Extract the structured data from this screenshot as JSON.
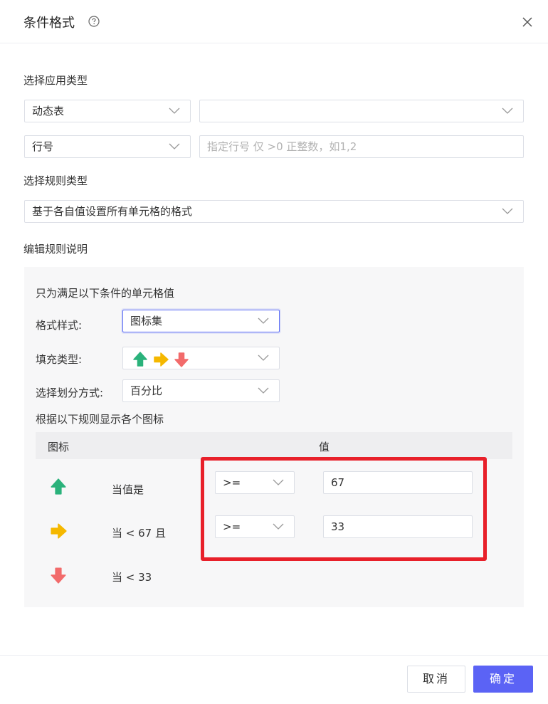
{
  "dialog": {
    "title": "条件格式"
  },
  "sections": {
    "apply_type": "选择应用类型",
    "rule_type": "选择规则类型",
    "edit_rule": "编辑规则说明"
  },
  "apply": {
    "type_select": "动态表",
    "second_select": "",
    "row_select": "行号",
    "row_input_placeholder": "指定行号 仅 >0 正整数，如1,2"
  },
  "rule": {
    "type_select": "基于各自值设置所有单元格的格式"
  },
  "panel": {
    "heading": "只为满足以下条件的单元格值",
    "format_style_label": "格式样式:",
    "format_style_value": "图标集",
    "fill_type_label": "填充类型:",
    "division_label": "选择划分方式:",
    "division_value": "百分比",
    "rules_heading": "根据以下规则显示各个图标",
    "table": {
      "col_icon": "图标",
      "col_value": "值"
    },
    "rows": [
      {
        "icon": "arrow-up-icon",
        "text": "当值是",
        "operator": ">=",
        "value": "67"
      },
      {
        "icon": "arrow-right-icon",
        "text": "当 < 67 且",
        "operator": ">=",
        "value": "33"
      },
      {
        "icon": "arrow-down-icon",
        "text": "当 < 33"
      }
    ]
  },
  "colors": {
    "green": "#2ab27b",
    "yellow": "#f5b800",
    "red": "#f26b6b",
    "primary": "#5b63f5",
    "highlight": "#e8202a"
  },
  "footer": {
    "cancel": "取消",
    "ok": "确定"
  }
}
